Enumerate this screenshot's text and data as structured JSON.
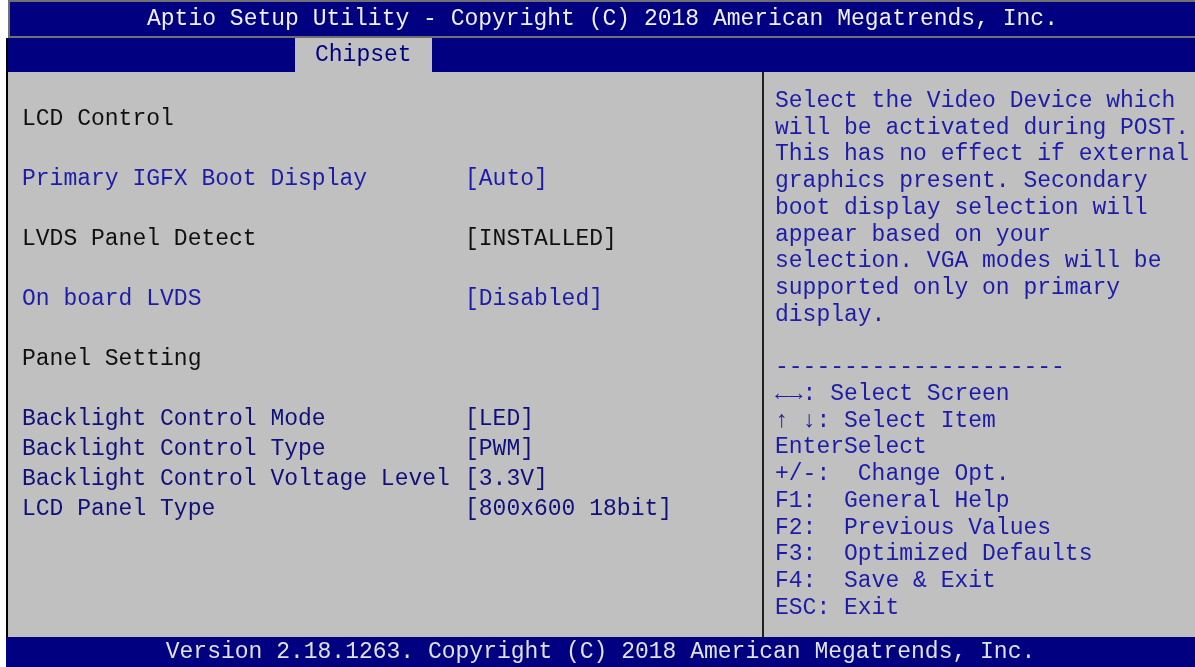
{
  "title_bar": {
    "title": "Aptio Setup Utility - Copyright (C) 2018 American Megatrends, Inc."
  },
  "tabs": [
    {
      "label": "Chipset",
      "selected": true
    }
  ],
  "settings": [
    {
      "kind": "heading",
      "label": "LCD Control"
    },
    {
      "kind": "option",
      "label": "Primary IGFX Boot Display",
      "value": "[Auto]",
      "selected": false
    },
    {
      "kind": "info",
      "label": "LVDS Panel Detect",
      "value": "[INSTALLED]"
    },
    {
      "kind": "option",
      "label": "On board LVDS",
      "value": "[Disabled]",
      "selected": false
    },
    {
      "kind": "heading",
      "label": "Panel Setting"
    },
    {
      "kind": "fixed",
      "label": "Backlight Control Mode",
      "value": "[LED]"
    },
    {
      "kind": "fixed",
      "label": "Backlight Control Type",
      "value": "[PWM]"
    },
    {
      "kind": "fixed",
      "label": "Backlight Control Voltage Level",
      "value": "[3.3V]"
    },
    {
      "kind": "fixed",
      "label": "LCD Panel Type",
      "value": "[800x600 18bit]"
    }
  ],
  "help": {
    "text": "Select the Video Device which will be activated during POST. This has no effect if external graphics present. Secondary boot display selection will appear based on your selection. VGA modes will be supported only on primary display.",
    "separator": "---------------------"
  },
  "key_legend": [
    "←→: Select Screen",
    "↑ ↓: Select Item",
    "EnterSelect",
    "+/-:  Change Opt.",
    "F1:  General Help",
    "F2:  Previous Values",
    "F3:  Optimized Defaults",
    "F4:  Save & Exit",
    "ESC: Exit"
  ],
  "status_bar": {
    "text": "Version 2.18.1263. Copyright (C) 2018 American Megatrends, Inc."
  }
}
